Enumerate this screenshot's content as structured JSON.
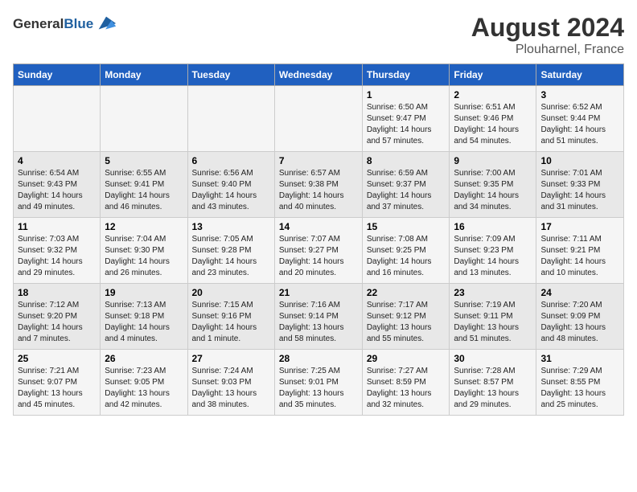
{
  "header": {
    "logo_general": "General",
    "logo_blue": "Blue",
    "month_year": "August 2024",
    "location": "Plouharnel, France"
  },
  "weekdays": [
    "Sunday",
    "Monday",
    "Tuesday",
    "Wednesday",
    "Thursday",
    "Friday",
    "Saturday"
  ],
  "weeks": [
    [
      {
        "day": "",
        "info": ""
      },
      {
        "day": "",
        "info": ""
      },
      {
        "day": "",
        "info": ""
      },
      {
        "day": "",
        "info": ""
      },
      {
        "day": "1",
        "info": "Sunrise: 6:50 AM\nSunset: 9:47 PM\nDaylight: 14 hours\nand 57 minutes."
      },
      {
        "day": "2",
        "info": "Sunrise: 6:51 AM\nSunset: 9:46 PM\nDaylight: 14 hours\nand 54 minutes."
      },
      {
        "day": "3",
        "info": "Sunrise: 6:52 AM\nSunset: 9:44 PM\nDaylight: 14 hours\nand 51 minutes."
      }
    ],
    [
      {
        "day": "4",
        "info": "Sunrise: 6:54 AM\nSunset: 9:43 PM\nDaylight: 14 hours\nand 49 minutes."
      },
      {
        "day": "5",
        "info": "Sunrise: 6:55 AM\nSunset: 9:41 PM\nDaylight: 14 hours\nand 46 minutes."
      },
      {
        "day": "6",
        "info": "Sunrise: 6:56 AM\nSunset: 9:40 PM\nDaylight: 14 hours\nand 43 minutes."
      },
      {
        "day": "7",
        "info": "Sunrise: 6:57 AM\nSunset: 9:38 PM\nDaylight: 14 hours\nand 40 minutes."
      },
      {
        "day": "8",
        "info": "Sunrise: 6:59 AM\nSunset: 9:37 PM\nDaylight: 14 hours\nand 37 minutes."
      },
      {
        "day": "9",
        "info": "Sunrise: 7:00 AM\nSunset: 9:35 PM\nDaylight: 14 hours\nand 34 minutes."
      },
      {
        "day": "10",
        "info": "Sunrise: 7:01 AM\nSunset: 9:33 PM\nDaylight: 14 hours\nand 31 minutes."
      }
    ],
    [
      {
        "day": "11",
        "info": "Sunrise: 7:03 AM\nSunset: 9:32 PM\nDaylight: 14 hours\nand 29 minutes."
      },
      {
        "day": "12",
        "info": "Sunrise: 7:04 AM\nSunset: 9:30 PM\nDaylight: 14 hours\nand 26 minutes."
      },
      {
        "day": "13",
        "info": "Sunrise: 7:05 AM\nSunset: 9:28 PM\nDaylight: 14 hours\nand 23 minutes."
      },
      {
        "day": "14",
        "info": "Sunrise: 7:07 AM\nSunset: 9:27 PM\nDaylight: 14 hours\nand 20 minutes."
      },
      {
        "day": "15",
        "info": "Sunrise: 7:08 AM\nSunset: 9:25 PM\nDaylight: 14 hours\nand 16 minutes."
      },
      {
        "day": "16",
        "info": "Sunrise: 7:09 AM\nSunset: 9:23 PM\nDaylight: 14 hours\nand 13 minutes."
      },
      {
        "day": "17",
        "info": "Sunrise: 7:11 AM\nSunset: 9:21 PM\nDaylight: 14 hours\nand 10 minutes."
      }
    ],
    [
      {
        "day": "18",
        "info": "Sunrise: 7:12 AM\nSunset: 9:20 PM\nDaylight: 14 hours\nand 7 minutes."
      },
      {
        "day": "19",
        "info": "Sunrise: 7:13 AM\nSunset: 9:18 PM\nDaylight: 14 hours\nand 4 minutes."
      },
      {
        "day": "20",
        "info": "Sunrise: 7:15 AM\nSunset: 9:16 PM\nDaylight: 14 hours\nand 1 minute."
      },
      {
        "day": "21",
        "info": "Sunrise: 7:16 AM\nSunset: 9:14 PM\nDaylight: 13 hours\nand 58 minutes."
      },
      {
        "day": "22",
        "info": "Sunrise: 7:17 AM\nSunset: 9:12 PM\nDaylight: 13 hours\nand 55 minutes."
      },
      {
        "day": "23",
        "info": "Sunrise: 7:19 AM\nSunset: 9:11 PM\nDaylight: 13 hours\nand 51 minutes."
      },
      {
        "day": "24",
        "info": "Sunrise: 7:20 AM\nSunset: 9:09 PM\nDaylight: 13 hours\nand 48 minutes."
      }
    ],
    [
      {
        "day": "25",
        "info": "Sunrise: 7:21 AM\nSunset: 9:07 PM\nDaylight: 13 hours\nand 45 minutes."
      },
      {
        "day": "26",
        "info": "Sunrise: 7:23 AM\nSunset: 9:05 PM\nDaylight: 13 hours\nand 42 minutes."
      },
      {
        "day": "27",
        "info": "Sunrise: 7:24 AM\nSunset: 9:03 PM\nDaylight: 13 hours\nand 38 minutes."
      },
      {
        "day": "28",
        "info": "Sunrise: 7:25 AM\nSunset: 9:01 PM\nDaylight: 13 hours\nand 35 minutes."
      },
      {
        "day": "29",
        "info": "Sunrise: 7:27 AM\nSunset: 8:59 PM\nDaylight: 13 hours\nand 32 minutes."
      },
      {
        "day": "30",
        "info": "Sunrise: 7:28 AM\nSunset: 8:57 PM\nDaylight: 13 hours\nand 29 minutes."
      },
      {
        "day": "31",
        "info": "Sunrise: 7:29 AM\nSunset: 8:55 PM\nDaylight: 13 hours\nand 25 minutes."
      }
    ]
  ]
}
